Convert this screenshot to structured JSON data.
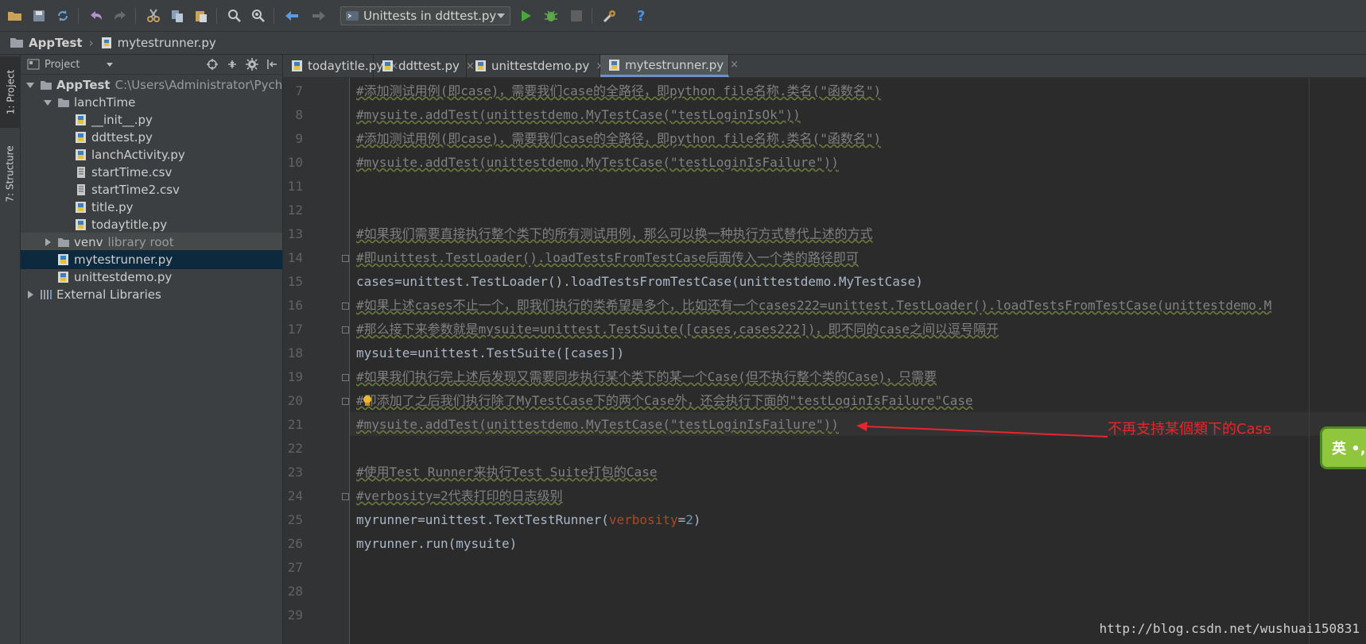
{
  "toolbar": {
    "run_config": "Unittests in ddttest.py",
    "icons": [
      "open-icon",
      "save-icon",
      "sync-icon",
      "undo-icon",
      "redo-icon",
      "cut-icon",
      "copy-icon",
      "paste-icon",
      "find-icon",
      "replace-icon",
      "back-icon",
      "forward-icon",
      "run-icon",
      "debug-icon",
      "stop-icon",
      "settings-icon",
      "help-icon"
    ]
  },
  "breadcrumb": {
    "project": "AppTest",
    "file": "mytestrunner.py"
  },
  "strip": {
    "project_tab": "1: Project",
    "structure_tab": "7: Structure"
  },
  "panel": {
    "title": "Project"
  },
  "tree": [
    {
      "label": "AppTest",
      "hint": "C:\\Users\\Administrator\\Pych",
      "type": "folder",
      "depth": 0,
      "expanded": true,
      "bold": true
    },
    {
      "label": "lanchTime",
      "type": "folder",
      "depth": 1,
      "expanded": true
    },
    {
      "label": "__init__.py",
      "type": "py",
      "depth": 2
    },
    {
      "label": "ddttest.py",
      "type": "py",
      "depth": 2
    },
    {
      "label": "lanchActivity.py",
      "type": "py",
      "depth": 2
    },
    {
      "label": "startTime.csv",
      "type": "txt",
      "depth": 2
    },
    {
      "label": "startTime2.csv",
      "type": "txt",
      "depth": 2
    },
    {
      "label": "title.py",
      "type": "py",
      "depth": 2
    },
    {
      "label": "todaytitle.py",
      "type": "py",
      "depth": 2
    },
    {
      "label": "venv",
      "hint": "library root",
      "type": "folder",
      "depth": 1,
      "expanded": false,
      "hover": true
    },
    {
      "label": "mytestrunner.py",
      "type": "py",
      "depth": 1,
      "selected": true
    },
    {
      "label": "unittestdemo.py",
      "type": "py",
      "depth": 1
    },
    {
      "label": "External Libraries",
      "type": "lib",
      "depth": 0,
      "expanded": false
    }
  ],
  "tabs": [
    {
      "label": "todaytitle.py",
      "active": false
    },
    {
      "label": "ddttest.py",
      "active": false
    },
    {
      "label": "unittestdemo.py",
      "active": false
    },
    {
      "label": "mytestrunner.py",
      "active": true
    }
  ],
  "code": [
    {
      "n": "7",
      "segs": [
        {
          "c": "comment",
          "t": "#添加测试用例(即case)，需要我们case的全路径，即python file名称.类名(\"函数名\")"
        }
      ]
    },
    {
      "n": "8",
      "segs": [
        {
          "c": "comment",
          "t": "#mysuite.addTest(unittestdemo.MyTestCase(\"testLoginIsOk\"))"
        }
      ]
    },
    {
      "n": "9",
      "segs": [
        {
          "c": "comment",
          "t": "#添加测试用例(即case)，需要我们case的全路径，即python file名称.类名(\"函数名\")"
        }
      ]
    },
    {
      "n": "10",
      "segs": [
        {
          "c": "comment",
          "t": "#mysuite.addTest(unittestdemo.MyTestCase(\"testLoginIsFailure\"))"
        }
      ]
    },
    {
      "n": "11",
      "segs": []
    },
    {
      "n": "12",
      "segs": []
    },
    {
      "n": "13",
      "segs": [
        {
          "c": "comment",
          "t": "#如果我们需要直接执行整个类下的所有测试用例，那么可以换一种执行方式替代上述的方式"
        }
      ]
    },
    {
      "n": "14",
      "fold": true,
      "segs": [
        {
          "c": "comment",
          "t": "#即unittest.TestLoader().loadTestsFromTestCase后面传入一个类的路径即可"
        }
      ]
    },
    {
      "n": "15",
      "segs": [
        {
          "c": "plain",
          "t": "cases=unittest.TestLoader().loadTestsFromTestCase(unittestdemo.MyTestCase)"
        }
      ]
    },
    {
      "n": "16",
      "fold": true,
      "segs": [
        {
          "c": "comment",
          "t": "#如果上述cases不止一个，即我们执行的类希望是多个，比如还有一个cases222=unittest.TestLoader().loadTestsFromTestCase(unittestdemo.M"
        }
      ]
    },
    {
      "n": "17",
      "fold": true,
      "segs": [
        {
          "c": "comment",
          "t": "#那么接下来参数就是mysuite=unittest.TestSuite([cases,cases222])，即不同的case之间以逗号隔开"
        }
      ]
    },
    {
      "n": "18",
      "segs": [
        {
          "c": "plain",
          "t": "mysuite=unittest.TestSuite([cases])"
        }
      ]
    },
    {
      "n": "19",
      "fold": true,
      "segs": [
        {
          "c": "comment",
          "t": "#如果我们执行完上述后发现又需要同步执行某个类下的某一个Case(但不执行整个类的Case)，只需要"
        }
      ]
    },
    {
      "n": "20",
      "fold": true,
      "bulb": true,
      "segs": [
        {
          "c": "comment",
          "t": "#即添加了之后我们执行除了MyTestCase下的两个Case外，还会执行下面的\"testLoginIsFailure\"Case"
        }
      ]
    },
    {
      "n": "21",
      "segs": [
        {
          "c": "comment",
          "t": "#mysuite.addTest(unittestdemo.MyTestCase(\"testLoginIsFailure\"))"
        }
      ]
    },
    {
      "n": "22",
      "segs": []
    },
    {
      "n": "23",
      "segs": [
        {
          "c": "comment",
          "t": "#使用Test Runner来执行Test Suite打包的Case"
        }
      ]
    },
    {
      "n": "24",
      "fold": true,
      "segs": [
        {
          "c": "comment",
          "t": "#verbosity=2代表打印的日志级别"
        }
      ]
    },
    {
      "n": "25",
      "segs": [
        {
          "c": "plain",
          "t": "myrunner=unittest.TextTestRunner("
        },
        {
          "c": "kw",
          "t": "verbosity"
        },
        {
          "c": "plain",
          "t": "="
        },
        {
          "c": "num",
          "t": "2"
        },
        {
          "c": "plain",
          "t": ")"
        }
      ]
    },
    {
      "n": "26",
      "segs": [
        {
          "c": "plain",
          "t": "myrunner.run(mysuite)"
        }
      ]
    },
    {
      "n": "27",
      "segs": []
    },
    {
      "n": "28",
      "segs": []
    },
    {
      "n": "29",
      "segs": []
    }
  ],
  "annotation": "不再支持某個類下的Case",
  "ime": "英 •,",
  "watermark": "http://blog.csdn.net/wushuai150831",
  "colors": {
    "accent": "#6a93c5",
    "annotation": "#e8252c",
    "comment": "#808080",
    "selection": "#0d293e"
  }
}
